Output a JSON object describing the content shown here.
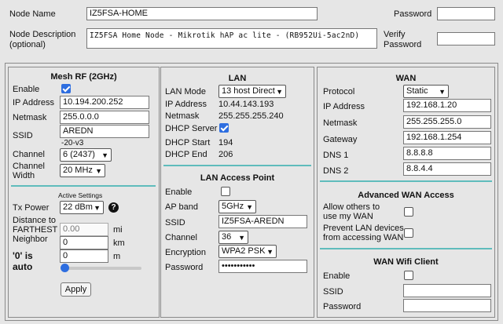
{
  "node": {
    "name_label": "Node Name",
    "name_value": "IZ5FSA-HOME",
    "desc_label_1": "Node Description",
    "desc_label_2": "(optional)",
    "desc_value": "IZ5FSA Home Node - Mikrotik hAP ac lite - (RB952Ui-5ac2nD)",
    "password_label": "Password",
    "verify_label_1": "Verify",
    "verify_label_2": "Password"
  },
  "mesh": {
    "title": "Mesh RF (2GHz)",
    "enable_label": "Enable",
    "enable_checked": true,
    "ip_label": "IP Address",
    "ip_value": "10.194.200.252",
    "netmask_label": "Netmask",
    "netmask_value": "255.0.0.0",
    "ssid_label": "SSID",
    "ssid_value": "AREDN",
    "ssid_suffix": "-20-v3",
    "channel_label": "Channel",
    "channel_value": "6 (2437)",
    "width_label_1": "Channel",
    "width_label_2": "Width",
    "width_value": "20 MHz",
    "active_settings": "Active Settings",
    "txpower_label": "Tx Power",
    "txpower_value": "22 dBm",
    "help_glyph": "?",
    "distance_label_1": "Distance to",
    "distance_label_2": "FARTHEST",
    "distance_label_3": "Neighbor",
    "auto_label_1": "'0' is",
    "auto_label_2": "auto",
    "dist_mi_value": "0.00",
    "dist_mi_unit": "mi",
    "dist_km_value": "0",
    "dist_km_unit": "km",
    "dist_m_value": "0",
    "dist_m_unit": "m",
    "slider_level": 0,
    "apply_label": "Apply"
  },
  "lan": {
    "title": "LAN",
    "mode_label": "LAN Mode",
    "mode_value": "13 host Direct",
    "ip_label": "IP Address",
    "ip_value": "10.44.143.193",
    "netmask_label": "Netmask",
    "netmask_value": "255.255.255.240",
    "dhcp_label": "DHCP Server",
    "dhcp_checked": true,
    "dhcp_start_label": "DHCP Start",
    "dhcp_start_value": "194",
    "dhcp_end_label": "DHCP End",
    "dhcp_end_value": "206",
    "ap_title": "LAN Access Point",
    "ap_enable_label": "Enable",
    "ap_enable_checked": false,
    "ap_band_label": "AP band",
    "ap_band_value": "5GHz",
    "ap_ssid_label": "SSID",
    "ap_ssid_value": "IZ5FSA-AREDN",
    "ap_channel_label": "Channel",
    "ap_channel_value": "36",
    "ap_enc_label": "Encryption",
    "ap_enc_value": "WPA2 PSK",
    "ap_password_label": "Password",
    "ap_password_value": "•••••••••••"
  },
  "wan": {
    "title": "WAN",
    "protocol_label": "Protocol",
    "protocol_value": "Static",
    "ip_label": "IP Address",
    "ip_value": "192.168.1.20",
    "netmask_label": "Netmask",
    "netmask_value": "255.255.255.0",
    "gateway_label": "Gateway",
    "gateway_value": "192.168.1.254",
    "dns1_label": "DNS 1",
    "dns1_value": "8.8.8.8",
    "dns2_label": "DNS 2",
    "dns2_value": "8.8.4.4",
    "adv_title": "Advanced WAN Access",
    "allow_label_1": "Allow others to",
    "allow_label_2": "use my WAN",
    "allow_checked": false,
    "prevent_label_1": "Prevent LAN devices",
    "prevent_label_2": "from accessing WAN",
    "prevent_checked": false,
    "client_title": "WAN Wifi Client",
    "client_enable_label": "Enable",
    "client_enable_checked": false,
    "client_ssid_label": "SSID",
    "client_ssid_value": "",
    "client_password_label": "Password",
    "client_password_value": ""
  },
  "colors": {
    "accent": "#2e6ee0",
    "divider": "#5fbcbc",
    "background": "#e6e6e6"
  },
  "icons": {
    "check": "check-icon",
    "caret": "chevron-down-icon",
    "help": "help-icon"
  }
}
